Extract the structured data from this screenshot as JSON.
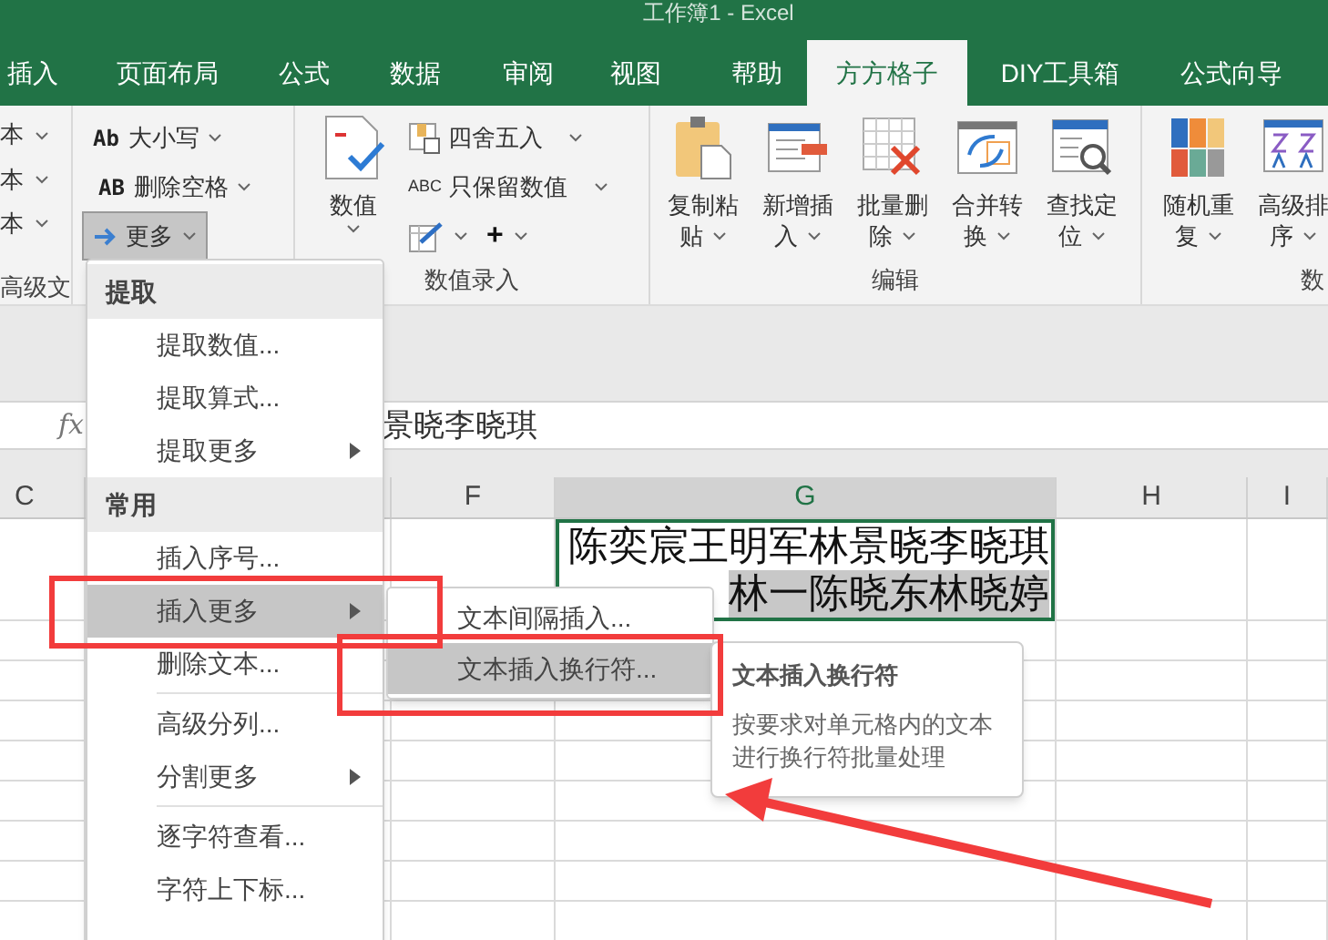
{
  "window": {
    "title": "工作簿1 - Excel"
  },
  "tabs": [
    {
      "label": "插入",
      "selected": false
    },
    {
      "label": "页面布局",
      "selected": false
    },
    {
      "label": "公式",
      "selected": false
    },
    {
      "label": "数据",
      "selected": false
    },
    {
      "label": "审阅",
      "selected": false
    },
    {
      "label": "视图",
      "selected": false
    },
    {
      "label": "帮助",
      "selected": false
    },
    {
      "label": "方方格子",
      "selected": true
    },
    {
      "label": "DIY工具箱",
      "selected": false
    },
    {
      "label": "公式向导",
      "selected": false
    }
  ],
  "ribbon": {
    "cut_group": {
      "items": [
        "本",
        "本",
        "本"
      ],
      "label": "高级文"
    },
    "text_group": {
      "items": [
        {
          "icon_text": "Ab",
          "label": "大小写",
          "pressed": false
        },
        {
          "icon_text": "AB",
          "label": "删除空格",
          "pressed": false
        },
        {
          "label": "更多",
          "pressed": true
        }
      ]
    },
    "number_group": {
      "big_button": "数值",
      "round_label": "四舍五入",
      "keep_icon_text": "ABC",
      "keep_label": "只保留数值",
      "plus": "+",
      "label": "数值录入"
    },
    "edit_group": {
      "buttons": [
        {
          "line1": "复制粘",
          "line2": "贴"
        },
        {
          "line1": "新增插",
          "line2": "入"
        },
        {
          "line1": "批量删",
          "line2": "除"
        },
        {
          "line1": "合并转",
          "line2": "换"
        },
        {
          "line1": "查找定",
          "line2": "位"
        }
      ],
      "label": "编辑"
    },
    "sort_group": {
      "buttons": [
        {
          "line1": "随机重",
          "line2": "复"
        },
        {
          "line1": "高级排",
          "line2": "序"
        }
      ],
      "label": "数"
    }
  },
  "formula_bar": {
    "fx": "fx",
    "content": "景晓李晓琪"
  },
  "columns": [
    {
      "label": "C",
      "selected": false
    },
    {
      "label": "F",
      "selected": false
    },
    {
      "label": "G",
      "selected": true
    },
    {
      "label": "H",
      "selected": false
    },
    {
      "label": "I",
      "selected": false
    }
  ],
  "active_cell": {
    "lines": [
      {
        "text": "陈奕宸王明军林景晓李晓琪",
        "selected": false
      },
      {
        "text": "林一陈晓东林晓婷",
        "selected": true
      }
    ]
  },
  "menu": {
    "items": [
      {
        "kind": "header",
        "label": "提取"
      },
      {
        "kind": "item",
        "label": "提取数值...",
        "submenu": false,
        "selected": false
      },
      {
        "kind": "item",
        "label": "提取算式...",
        "submenu": false,
        "selected": false
      },
      {
        "kind": "item",
        "label": "提取更多",
        "submenu": true,
        "selected": false
      },
      {
        "kind": "header",
        "label": "常用"
      },
      {
        "kind": "item",
        "label": "插入序号...",
        "submenu": false,
        "selected": false
      },
      {
        "kind": "item",
        "label": "插入更多",
        "submenu": true,
        "selected": true
      },
      {
        "kind": "item",
        "label": "删除文本...",
        "submenu": false,
        "selected": false
      },
      {
        "kind": "separator"
      },
      {
        "kind": "item",
        "label": "高级分列...",
        "submenu": false,
        "selected": false
      },
      {
        "kind": "item",
        "label": "分割更多",
        "submenu": true,
        "selected": false
      },
      {
        "kind": "separator"
      },
      {
        "kind": "item",
        "label": "逐字符查看...",
        "submenu": false,
        "selected": false
      },
      {
        "kind": "item",
        "label": "字符上下标...",
        "submenu": false,
        "selected": false
      }
    ]
  },
  "submenu": {
    "items": [
      {
        "label": "文本间隔插入...",
        "selected": false
      },
      {
        "label": "文本插入换行符...",
        "selected": true
      }
    ]
  },
  "tooltip": {
    "title": "文本插入换行符",
    "body": "按要求对单元格内的文本进行换行符批量处理"
  }
}
